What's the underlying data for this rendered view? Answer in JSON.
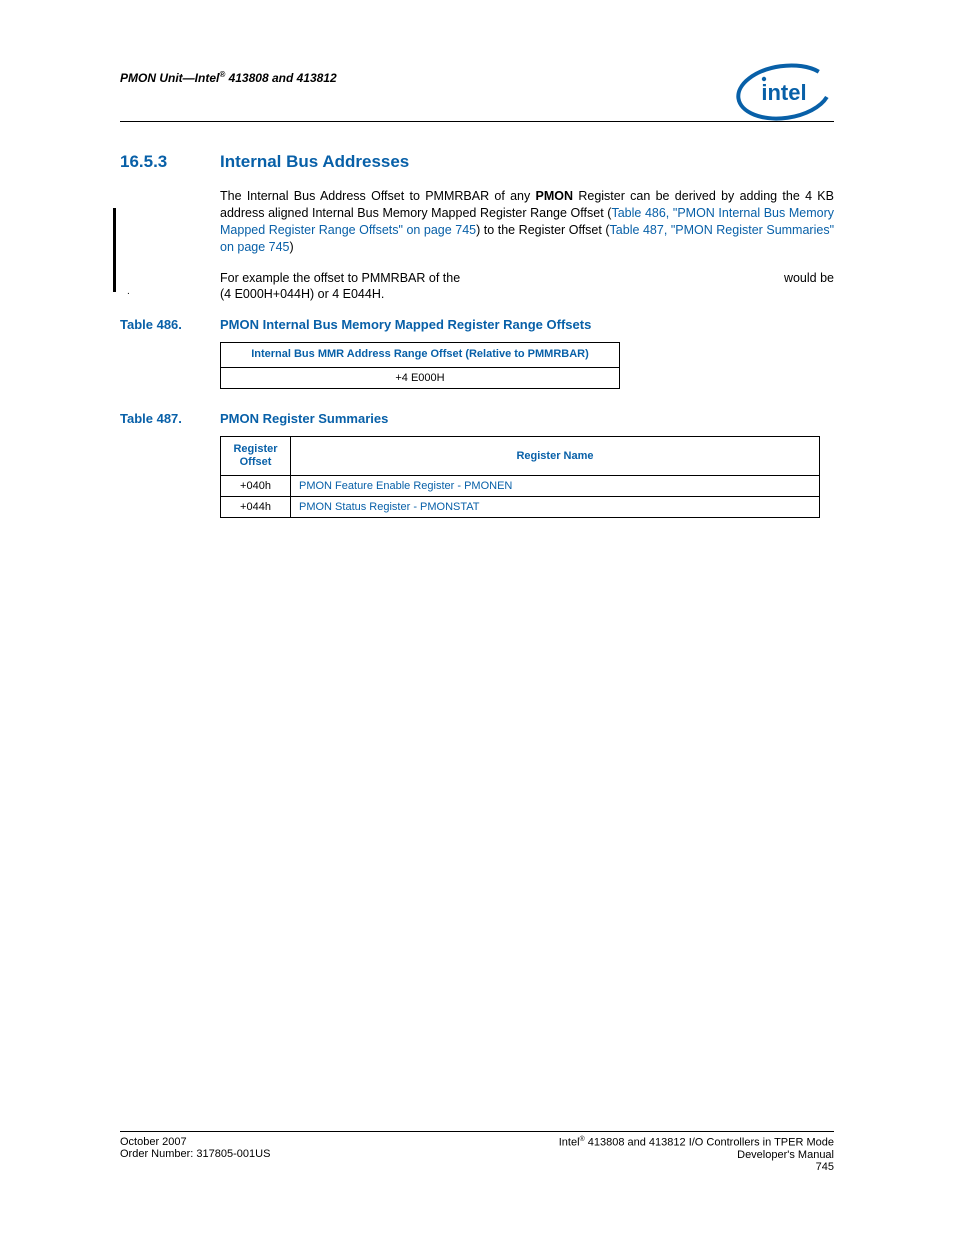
{
  "header": {
    "left_pre": "PMON Unit—Intel",
    "left_sup": "®",
    "left_post": " 413808 and 413812"
  },
  "section": {
    "number": "16.5.3",
    "title": "Internal Bus Addresses"
  },
  "p1_a": "The Internal Bus Address Offset to PMMRBAR of any ",
  "p1_bold": "PMON",
  "p1_b": " Register can be derived by adding the 4 KB address aligned Internal Bus Memory Mapped Register Range Offset (",
  "p1_link1": "Table 486, \"PMON Internal Bus Memory Mapped Register Range Offsets\" on page 745",
  "p1_c": ") to the Register Offset (",
  "p1_link2": "Table 487, \"PMON Register Summaries\" on page 745",
  "p1_d": ")",
  "p2_a": "For example the offset to PMMRBAR of the ",
  "p2_b": " would be (4 E000H+044H) or 4 E044H.",
  "table486": {
    "label": "Table 486.",
    "title": "PMON Internal Bus Memory Mapped Register Range Offsets",
    "header": "Internal Bus MMR Address Range Offset (Relative to PMMRBAR)",
    "row": "+4 E000H"
  },
  "table487": {
    "label": "Table 487.",
    "title": "PMON Register Summaries",
    "col1": "Register Offset",
    "col2": "Register Name",
    "rows": [
      {
        "offset": "+040h",
        "name": "PMON Feature Enable Register - PMONEN"
      },
      {
        "offset": "+044h",
        "name": "PMON Status Register - PMONSTAT"
      }
    ]
  },
  "footer": {
    "left1": "October 2007",
    "left2": "Order Number: 317805-001US",
    "right1_a": "Intel",
    "right1_sup": "®",
    "right1_b": " 413808 and 413812 I/O Controllers in TPER Mode",
    "right2": "Developer's Manual",
    "pagenum": "745"
  }
}
